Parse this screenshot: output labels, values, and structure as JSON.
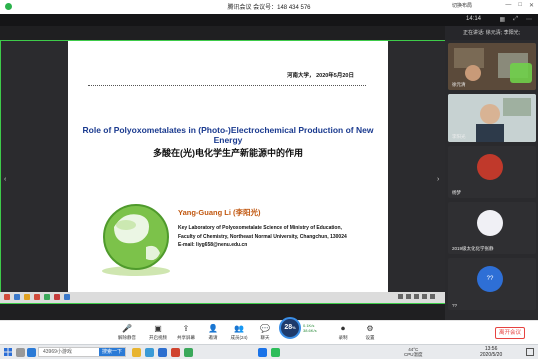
{
  "window": {
    "title": "腾讯会议 会议号：148 434 576"
  },
  "topbar": {
    "clock": "14:14",
    "layout_label": "切换布局"
  },
  "slide": {
    "date_line": "河南大学， 2020年5月20日",
    "en_title": "Role of Polyoxometalates in (Photo-)Electrochemical Production of New Energy",
    "cn_title": "多酸在(光)电化学生产新能源中的作用",
    "author": "Yang-Guang Li (李阳光)",
    "affiliation_lines": [
      "Key Laboratory of Polyoxometalate Science of Ministry of Education,",
      "Faculty of Chemistry, Northeast Normal University, Changchun, 130024",
      "E-mail: liyg658@nenu.edu.cn"
    ]
  },
  "panel": {
    "speaking_label": "正在讲话: 徐元清; 李阳光;",
    "tiles": [
      {
        "name": "徐元清"
      },
      {
        "name": "李阳光"
      },
      {
        "name": "杨梦"
      },
      {
        "name": "2019级太化化学张静"
      },
      {
        "name": "??"
      }
    ]
  },
  "toolbar": {
    "items": [
      {
        "label": "解除静音",
        "icon": "mic-muted-icon"
      },
      {
        "label": "开启视频",
        "icon": "camera-off-icon"
      },
      {
        "label": "共享屏幕",
        "icon": "share-screen-icon"
      },
      {
        "label": "邀请",
        "icon": "invite-icon"
      },
      {
        "label": "成员(24)",
        "icon": "members-icon"
      },
      {
        "label": "聊天",
        "icon": "chat-icon"
      },
      {
        "label": "录制",
        "icon": "record-icon"
      },
      {
        "label": "设置",
        "icon": "settings-icon"
      }
    ],
    "speed_value": "28",
    "speed_unit": "%",
    "net_up": "0.1K/s",
    "net_down": "38.6K/s",
    "leave_label": "离开会议"
  },
  "taskbar": {
    "search_text": "43969小游戏",
    "search_button": "搜索一下",
    "weather_temp": "44°C",
    "weather_label": "CPU温度",
    "time": "13:56",
    "date": "2020/5/20"
  },
  "colors": {
    "accent_green": "#3ecb4a",
    "slide_title_blue": "#1a3a8f",
    "author_orange": "#c1570f",
    "leave_red": "#e64340"
  }
}
